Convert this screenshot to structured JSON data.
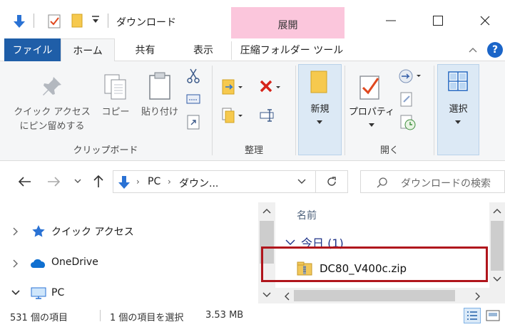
{
  "window": {
    "title": "ダウンロード",
    "context_tab_header": "展開",
    "colors": {
      "file_tab": "#1f5ea8",
      "context_header": "#fbc6dc",
      "highlight": "#b0151c"
    }
  },
  "ribbon_tabs": {
    "file": "ファイル",
    "home": "ホーム",
    "share": "共有",
    "view": "表示",
    "tools": "圧縮フォルダー ツール"
  },
  "ribbon": {
    "clipboard": {
      "pin_label_1": "クイック アクセス",
      "pin_label_2": "にピン留めする",
      "copy_label": "コピー",
      "paste_label": "貼り付け",
      "group_label": "クリップボード"
    },
    "organize": {
      "group_label": "整理"
    },
    "new": {
      "new_label": "新規"
    },
    "open": {
      "properties_label": "プロパティ",
      "group_label": "開く"
    },
    "select": {
      "select_label": "選択"
    }
  },
  "address": {
    "path_root": "PC",
    "path_folder": "ダウン...",
    "search_placeholder": "ダウンロードの検索"
  },
  "nav": {
    "quick_access": "クイック アクセス",
    "onedrive": "OneDrive",
    "pc": "PC"
  },
  "files": {
    "column_name": "名前",
    "group_today": "今日 (1)",
    "items": [
      {
        "name": "DC80_V400c.zip"
      }
    ]
  },
  "status": {
    "item_count": "531 個の項目",
    "selection": "1 個の項目を選択",
    "size": "3.53 MB"
  }
}
